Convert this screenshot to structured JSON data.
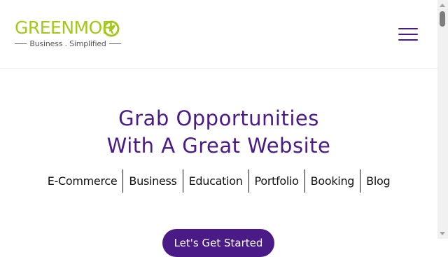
{
  "header": {
    "logo_text": "GREENMOR",
    "tagline": "Business . Simplified",
    "menu_icon": "hamburger-icon"
  },
  "hero": {
    "title_line1": "Grab Opportunities",
    "title_line2": "With A Great Website",
    "categories": [
      "E-Commerce",
      "Business",
      "Education",
      "Portfolio",
      "Booking",
      "Blog"
    ],
    "cta_label": "Let's Get Started"
  },
  "colors": {
    "brand_green": "#a4c81a",
    "brand_purple": "#4a1a87"
  }
}
